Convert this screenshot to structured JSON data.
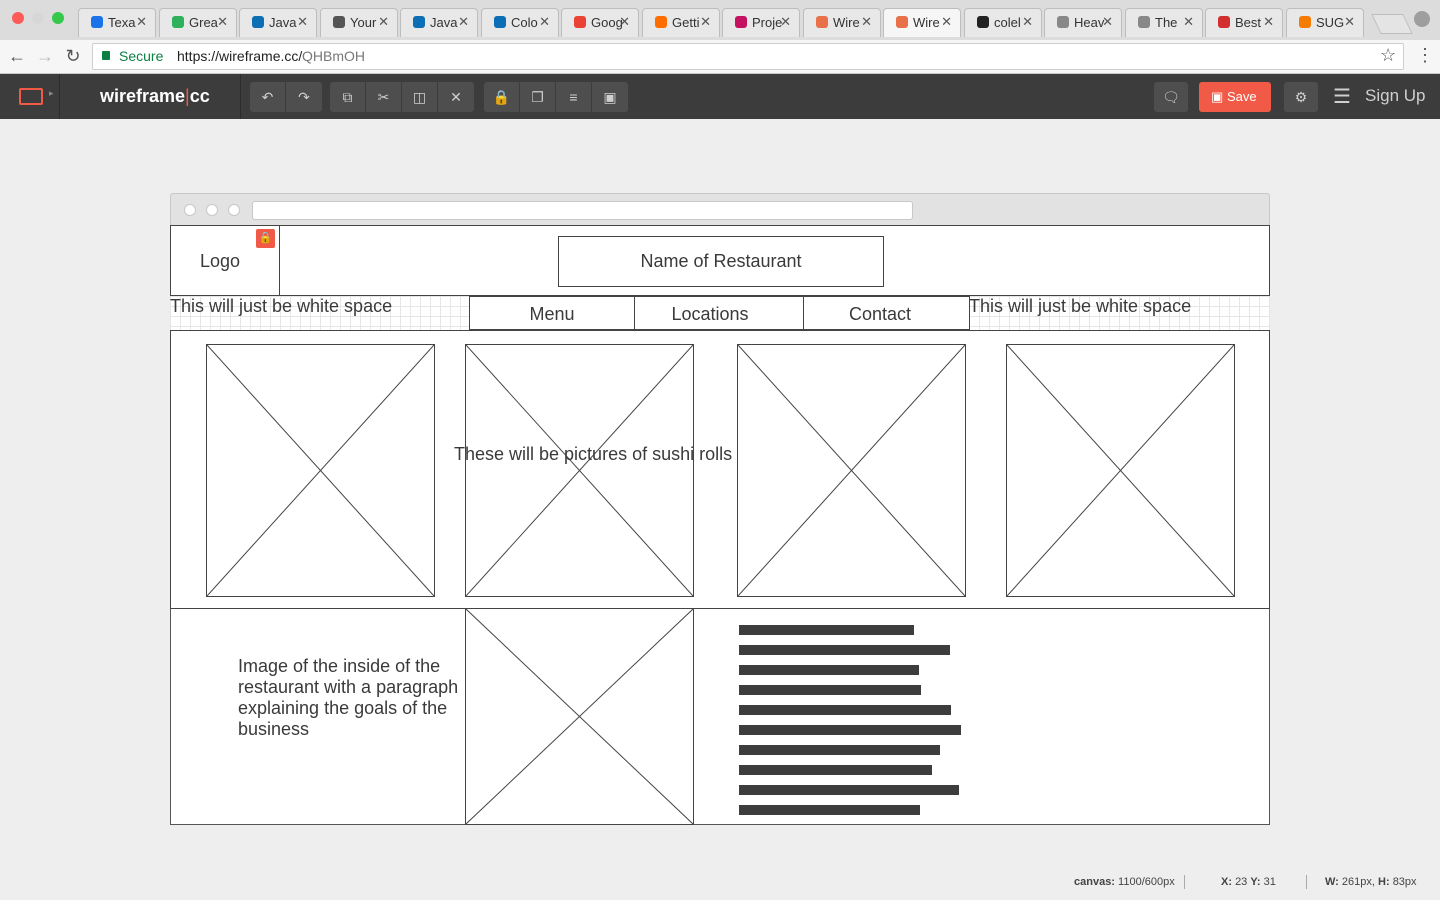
{
  "browser": {
    "tabs": [
      {
        "label": "Texa",
        "color": "#1a73e8"
      },
      {
        "label": "Grea",
        "color": "#2eb15a"
      },
      {
        "label": "Java",
        "color": "#0c6fb5"
      },
      {
        "label": "Your",
        "color": "#555555"
      },
      {
        "label": "Java",
        "color": "#0c6fb5"
      },
      {
        "label": "Colo",
        "color": "#0c6fb5"
      },
      {
        "label": "Goog",
        "color": "#ea4335"
      },
      {
        "label": "Getti",
        "color": "#ff6d00"
      },
      {
        "label": "Proje",
        "color": "#c51162"
      },
      {
        "label": "Wire",
        "color": "#e8714a"
      },
      {
        "label": "Wire",
        "color": "#e8714a"
      },
      {
        "label": "colel",
        "color": "#222222"
      },
      {
        "label": "Heav",
        "color": "#888888"
      },
      {
        "label": "The",
        "color": "#888888"
      },
      {
        "label": "Best",
        "color": "#d32f2f"
      },
      {
        "label": "SUG",
        "color": "#f57c00"
      }
    ],
    "active_tab_index": 10,
    "secure_label": "Secure",
    "url_host": "https://wireframe.cc/",
    "url_path": "QHBmOH"
  },
  "toolbar": {
    "brand_name": "wireframe",
    "brand_sep": "|",
    "brand_suffix": "cc",
    "save_label": "Save",
    "signup_label": "Sign Up",
    "accent_color": "#f05a46"
  },
  "wireframe": {
    "logo_label": "Logo",
    "restaurant_name": "Name of Restaurant",
    "whitespace_left": "This will just be white space",
    "whitespace_right": "This will just be white space",
    "nav": [
      "Menu",
      "Locations",
      "Contact"
    ],
    "sushi_caption": "These will be pictures of sushi rolls",
    "about_lines": [
      "Image of the inside of the",
      "restaurant with a paragraph",
      "explaining the goals of the",
      "business"
    ]
  },
  "status": {
    "canvas_label": "canvas:",
    "canvas_value": "1100/600px",
    "x_label": "X:",
    "x_value": "23",
    "y_label": "Y:",
    "y_value": "31",
    "w_label": "W:",
    "w_value": "261px,",
    "h_label": "H:",
    "h_value": "83px"
  }
}
